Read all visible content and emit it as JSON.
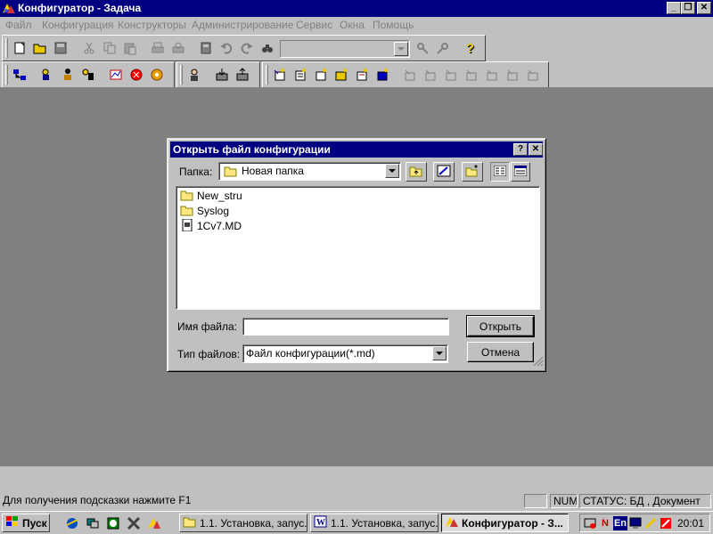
{
  "window": {
    "title": "Конфигуратор - Задача",
    "minimize": "_",
    "maximize": "❐",
    "close": "✕"
  },
  "menu": [
    "Файл",
    "Конфигурация",
    "Конструкторы",
    "Администрирование",
    "Сервис",
    "Окна",
    "Помощь"
  ],
  "toolbar_combo_value": "",
  "dialog": {
    "title": "Открыть файл конфигурации",
    "help": "?",
    "close": "✕",
    "folder_label": "Папка:",
    "folder_value": "Новая папка",
    "files": [
      {
        "name": "New_stru",
        "icon": "folder-icon"
      },
      {
        "name": "Syslog",
        "icon": "folder-icon"
      },
      {
        "name": "1Cv7.MD",
        "icon": "md-file-icon"
      }
    ],
    "filename_label": "Имя файла:",
    "filename_value": "",
    "filetype_label": "Тип файлов:",
    "filetype_value": "Файл конфигурации(*.md)",
    "open_button": "Открыть",
    "cancel_button": "Отмена"
  },
  "statusbar": {
    "hint": "Для получения подсказки нажмите F1",
    "empty_panel": "",
    "num": "NUM",
    "status": "СТАТУС: БД , Документ"
  },
  "taskbar": {
    "start": "Пуск",
    "tasks": [
      {
        "label": "1.1. Установка, запус...",
        "icon": "folder-icon",
        "active": false
      },
      {
        "label": "1.1. Установка, запус...",
        "icon": "word-icon",
        "active": false
      },
      {
        "label": "Конфигуратор - З...",
        "icon": "app-icon",
        "active": true
      }
    ],
    "tray_lang": "En",
    "tray_n": "N",
    "clock": "20:01"
  }
}
